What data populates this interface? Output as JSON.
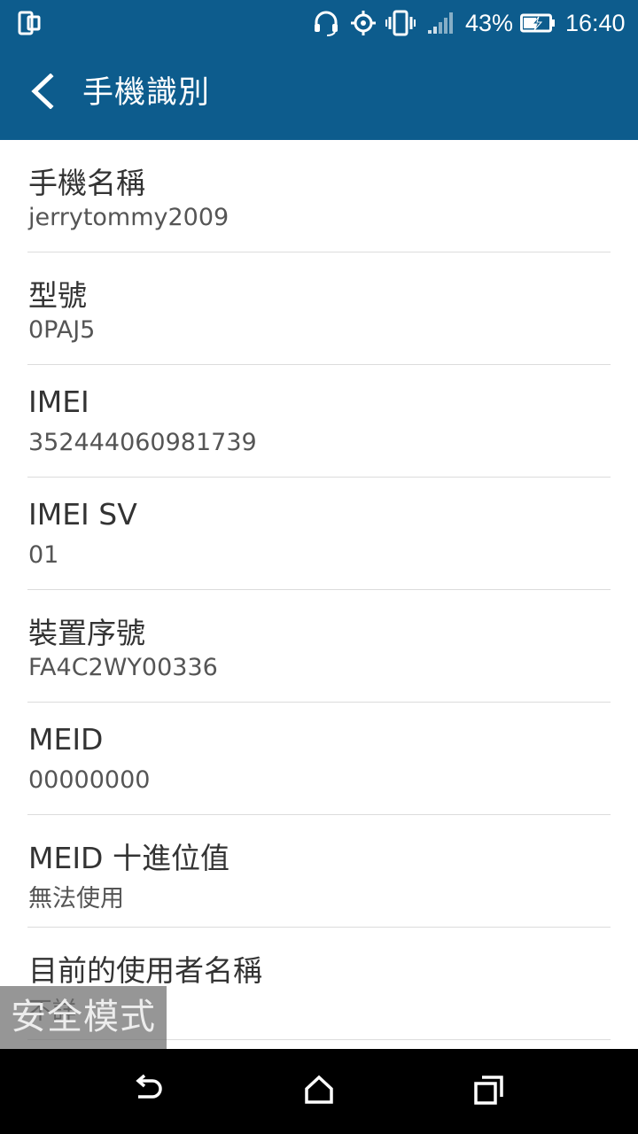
{
  "status_bar": {
    "battery_percent": "43%",
    "time": "16:40",
    "icons": [
      "device-icon",
      "headset-icon",
      "location-icon",
      "vibrate-icon",
      "signal-icon",
      "battery-charging-icon"
    ]
  },
  "app_bar": {
    "title": "手機識別",
    "back_icon": "back-arrow-icon"
  },
  "rows": [
    {
      "label": "手機名稱",
      "value": "jerrytommy2009"
    },
    {
      "label": "型號",
      "value": "0PAJ5"
    },
    {
      "label": "IMEI",
      "value": "352444060981739"
    },
    {
      "label": "IMEI SV",
      "value": "01"
    },
    {
      "label": "裝置序號",
      "value": "FA4C2WY00336"
    },
    {
      "label": "MEID",
      "value": "00000000"
    },
    {
      "label": "MEID 十進位值",
      "value": "無法使用"
    },
    {
      "label": "目前的使用者名稱",
      "value": "不詳"
    }
  ],
  "overlay": {
    "safe_mode": "安全模式"
  },
  "nav_bar": {
    "icons": [
      "back-icon",
      "home-icon",
      "recents-icon"
    ]
  },
  "colors": {
    "primary": "#0d5c8d",
    "nav_bar": "#000000",
    "divider": "#dcdcdc"
  }
}
